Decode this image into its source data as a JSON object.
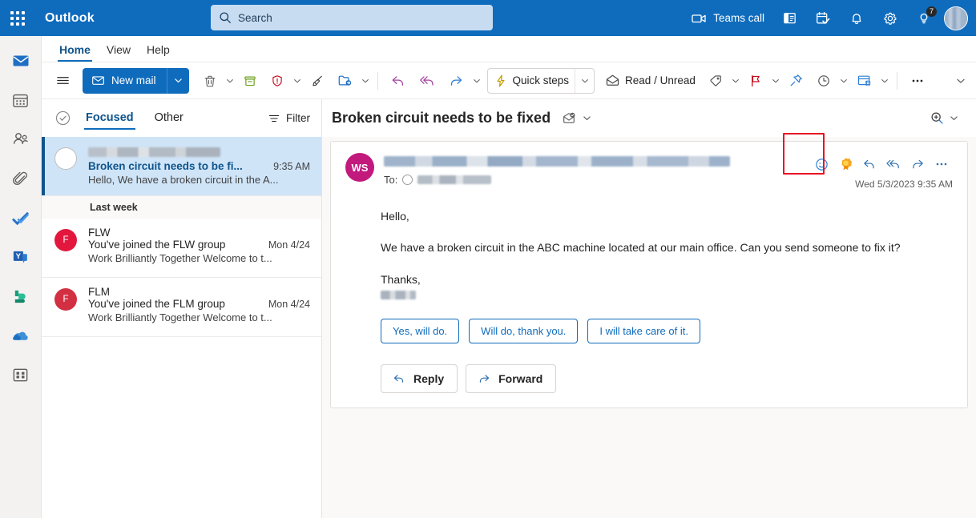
{
  "app": {
    "brand": "Outlook"
  },
  "search": {
    "placeholder": "Search",
    "value": "",
    "icon": "search-icon"
  },
  "topbar": {
    "waffle_icon": "app-launcher-icon",
    "teams_call_label": "Teams call",
    "teams_call_icon": "video-camera-icon",
    "items": [
      {
        "name": "outlook-contacts-card-icon",
        "icon": "contact-card-icon"
      },
      {
        "name": "calendar-check-icon",
        "icon": "calendar-check-icon"
      },
      {
        "name": "notifications-icon",
        "icon": "bell-icon"
      },
      {
        "name": "settings-icon",
        "icon": "gear-icon"
      },
      {
        "name": "tips-icon",
        "icon": "lightbulb-icon",
        "badge": "7"
      }
    ],
    "avatar_label": ""
  },
  "rail": {
    "items": [
      {
        "name": "mail",
        "icon": "mail-icon",
        "active": true
      },
      {
        "name": "calendar",
        "icon": "calendar-icon",
        "active": false
      },
      {
        "name": "people",
        "icon": "people-icon",
        "active": false
      },
      {
        "name": "files",
        "icon": "paperclip-icon",
        "active": false
      },
      {
        "name": "to-do",
        "icon": "checkmark-icon",
        "active": false
      },
      {
        "name": "yammer",
        "icon": "yammer-icon",
        "active": false
      },
      {
        "name": "bookings",
        "icon": "bookings-icon",
        "active": false
      },
      {
        "name": "onedrive",
        "icon": "cloud-icon",
        "active": false
      },
      {
        "name": "more-apps",
        "icon": "apps-grid-icon",
        "active": false
      }
    ]
  },
  "ribbon": {
    "tabs": [
      {
        "label": "Home",
        "active": true
      },
      {
        "label": "View",
        "active": false
      },
      {
        "label": "Help",
        "active": false
      }
    ],
    "expand_icon": "chevron-down-icon"
  },
  "commandbar": {
    "hamburger_icon": "hamburger-menu-icon",
    "new_mail": {
      "label": "New mail",
      "icon": "envelope-icon",
      "caret_icon": "chevron-down-icon"
    },
    "delete": {
      "icon": "trash-icon",
      "caret": true
    },
    "archive": {
      "icon": "archive-icon",
      "caret": false
    },
    "report": {
      "icon": "shield-alert-icon",
      "caret": true
    },
    "sweep": {
      "icon": "broom-icon",
      "caret": false
    },
    "move_to": {
      "icon": "folder-arrow-icon",
      "caret": true
    },
    "reply": {
      "icon": "reply-icon",
      "caret": false
    },
    "reply_all": {
      "icon": "reply-all-icon",
      "caret": false
    },
    "forward": {
      "icon": "forward-icon",
      "caret": true
    },
    "quick_steps": {
      "label": "Quick steps",
      "icon": "lightning-bolt-icon",
      "caret": true
    },
    "read_unread": {
      "label": "Read / Unread",
      "icon": "open-envelope-icon"
    },
    "tag": {
      "icon": "tag-icon",
      "caret": true
    },
    "flag": {
      "icon": "flag-icon",
      "caret": true
    },
    "pin": {
      "icon": "pin-icon",
      "caret": false
    },
    "snooze": {
      "icon": "clock-icon",
      "caret": true
    },
    "rules": {
      "icon": "rules-icon",
      "caret": true
    },
    "more": {
      "icon": "ellipsis-icon"
    }
  },
  "messagelist": {
    "select_all_icon": "select-all-circle-icon",
    "pivots": [
      {
        "label": "Focused",
        "active": true
      },
      {
        "label": "Other",
        "active": false
      }
    ],
    "filter": {
      "label": "Filter",
      "icon": "filter-icon"
    },
    "group_header": "Last week",
    "items": [
      {
        "sender": "",
        "sender_redacted": true,
        "subject": "Broken circuit needs to be fi...",
        "time": "9:35 AM",
        "preview": "Hello, We have a broken circuit in the A...",
        "selected": true,
        "avatar_initial": "",
        "avatar_color": "#ffffff"
      },
      {
        "sender": "FLW",
        "sender_redacted": false,
        "subject": "You've joined the FLW group",
        "time": "Mon 4/24",
        "preview": "Work Brilliantly Together Welcome to t...",
        "selected": false,
        "avatar_initial": "F",
        "avatar_color": "#e3173e"
      },
      {
        "sender": "FLM",
        "sender_redacted": false,
        "subject": "You've joined the FLM group",
        "time": "Mon 4/24",
        "preview": "Work Brilliantly Together Welcome to t...",
        "selected": false,
        "avatar_initial": "F",
        "avatar_color": "#d32f43"
      }
    ]
  },
  "reading_pane": {
    "subject": "Broken circuit needs to be fixed",
    "subject_icon": "read-receipt-icon",
    "subject_caret_icon": "chevron-down-icon",
    "zoom": {
      "icon": "zoom-in-icon",
      "caret_icon": "chevron-down-icon"
    },
    "sender_avatar_initials": "WS",
    "sender_avatar_color": "#c2197d",
    "sender_redacted": true,
    "to_label": "To:",
    "to_redacted": true,
    "date": "Wed 5/3/2023 9:35 AM",
    "actions": [
      {
        "name": "add-reaction-icon",
        "highlighted": false
      },
      {
        "name": "praise-award-icon",
        "highlighted": true
      },
      {
        "name": "reply-icon",
        "highlighted": false
      },
      {
        "name": "reply-all-icon",
        "highlighted": false
      },
      {
        "name": "forward-icon",
        "highlighted": false
      },
      {
        "name": "more-actions-icon",
        "highlighted": false
      }
    ],
    "highlight_color": "#e81123",
    "body": {
      "greeting": "Hello,",
      "paragraph": "We have a broken circuit in the ABC machine located at   our main office. Can you send someone to fix it?",
      "closing": "Thanks,",
      "signature_redacted": true
    },
    "suggestions": [
      "Yes, will do.",
      "Will do, thank you.",
      "I will take care of it."
    ],
    "reply_button": {
      "label": "Reply",
      "icon": "reply-icon"
    },
    "forward_button": {
      "label": "Forward",
      "icon": "forward-icon"
    }
  },
  "colors": {
    "brand_blue": "#0f6cbd",
    "accent_dark_blue": "#0f548c",
    "selection_blue": "#cfe4f7",
    "highlight_red": "#e81123",
    "award_gold": "#f7a600"
  }
}
